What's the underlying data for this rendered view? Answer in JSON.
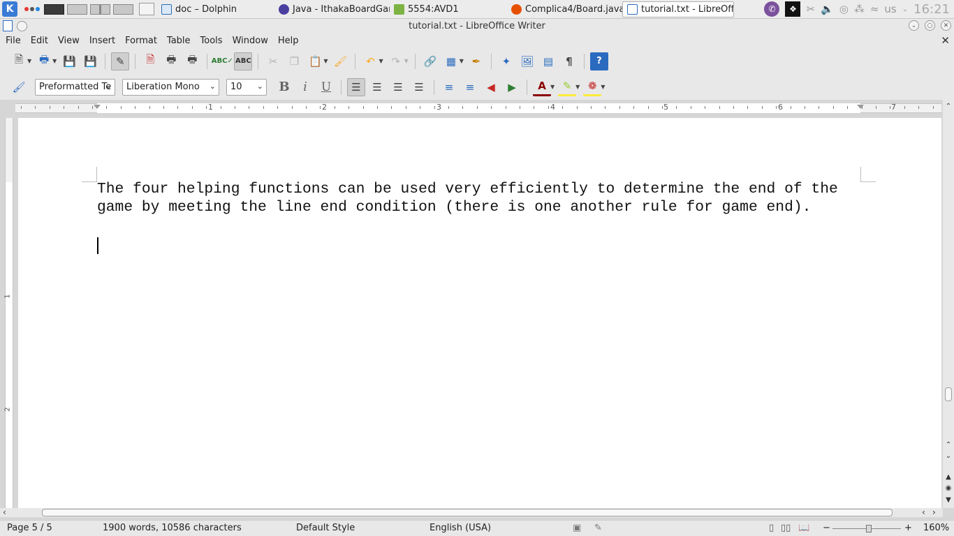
{
  "taskbar": {
    "launcher_letter": "K",
    "tasks": [
      {
        "label": "doc – Dolphin",
        "color": "#2f6db5"
      },
      {
        "label": "Java - IthakaBoardGam",
        "color": "#4a3fa0"
      },
      {
        "label": "5554:AVD1",
        "color": "#7cb342"
      },
      {
        "label": "Complica4/Board.java",
        "color": "#e65100"
      },
      {
        "label": "tutorial.txt - LibreOffic",
        "color": "#2a6bbf"
      }
    ],
    "keyboard_layout": "us",
    "clock": "16:21"
  },
  "window": {
    "title": "tutorial.txt - LibreOffice Writer"
  },
  "menu": [
    "File",
    "Edit",
    "View",
    "Insert",
    "Format",
    "Table",
    "Tools",
    "Window",
    "Help"
  ],
  "formatting": {
    "paragraph_style": "Preformatted Te",
    "font_name": "Liberation Mono",
    "font_size": "10"
  },
  "ruler": {
    "h_labels": [
      "1",
      "2",
      "3",
      "4",
      "5",
      "6",
      "7"
    ],
    "v_labels": [
      "1",
      "2"
    ]
  },
  "document": {
    "text": "The four helping functions can be used very efficiently to determine the end of the game by meeting the line end condition (there is one another rule for game end)."
  },
  "status": {
    "page": "Page 5 / 5",
    "word_count": "1900 words, 10586 characters",
    "page_style": "Default Style",
    "language": "English (USA)",
    "zoom": "160%"
  },
  "colors": {
    "accent": "#2a6bbf",
    "toolbar_bg": "#e8e8e8",
    "page_bg": "#ffffff"
  }
}
